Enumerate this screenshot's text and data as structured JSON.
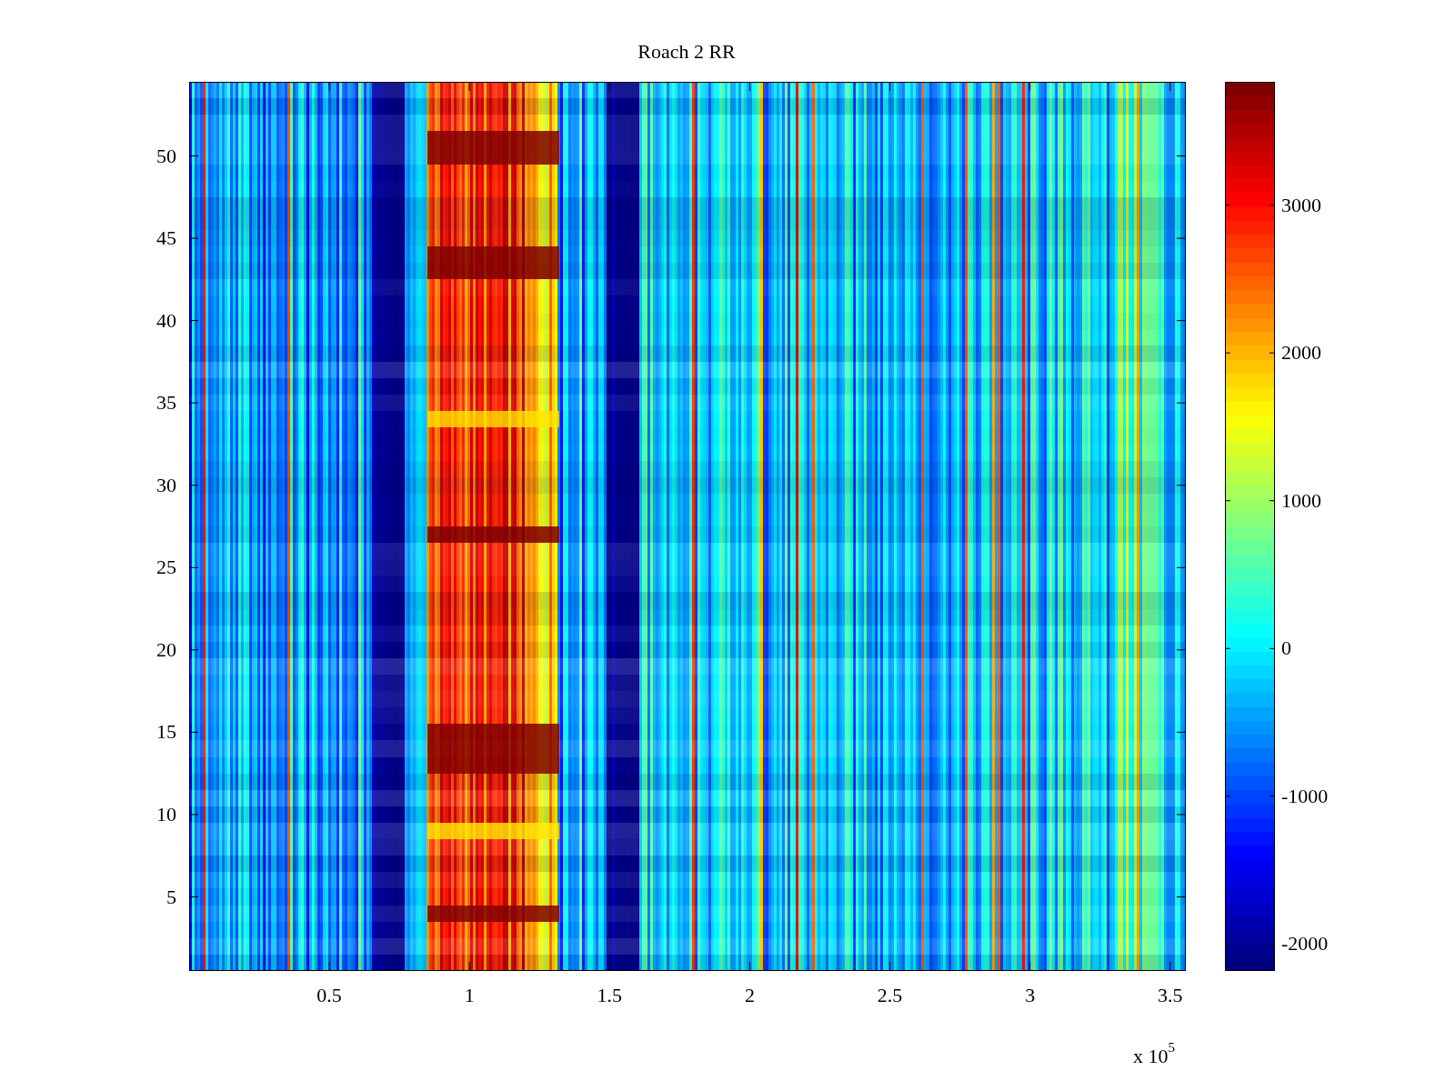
{
  "figure": {
    "title": "Roach 2 RR",
    "x_tick_labels": [
      "0.5",
      "1",
      "1.5",
      "2",
      "2.5",
      "3",
      "3.5"
    ],
    "x_multiplier": "x 10$^{5}$",
    "y_tick_labels": [
      "50",
      "45",
      "40",
      "35",
      "30",
      "25",
      "20",
      "15",
      "10",
      "5"
    ],
    "colorbar": {
      "tick_labels": [
        "3000",
        "2000",
        "1000",
        "0",
        "-1000",
        "-2000"
      ]
    }
  }
}
